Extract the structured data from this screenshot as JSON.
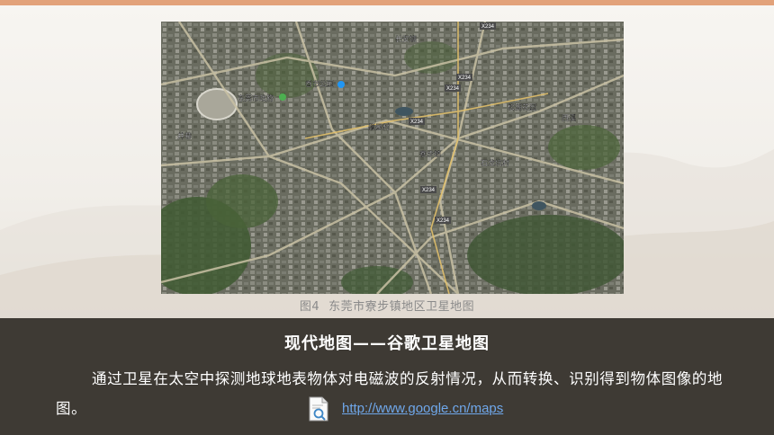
{
  "slide": {
    "figure_caption_number": "图4",
    "figure_caption_text": "东莞市寮步镇地区卫星地图",
    "heading": "现代地图——谷歌卫星地图",
    "body": "通过卫星在太空中探测地球地表物体对电磁波的反射情况，从而转换、识别得到物体图像的地图。",
    "link_text": "http://www.google.cn/maps",
    "icon": "document-search-icon"
  },
  "map": {
    "labels": [
      "东莞市政府",
      "寮步镇",
      "香市公园",
      "石龙坑村",
      "颜屋村",
      "松湖花园",
      "长安塘",
      "西溪",
      "井巷"
    ],
    "roads": [
      "X234",
      "X234",
      "X234",
      "X234",
      "X234",
      "X234"
    ]
  },
  "colors": {
    "top_bar": "#e2a27a",
    "bottom_panel": "#3e3a34",
    "link": "#6fa7ea"
  }
}
